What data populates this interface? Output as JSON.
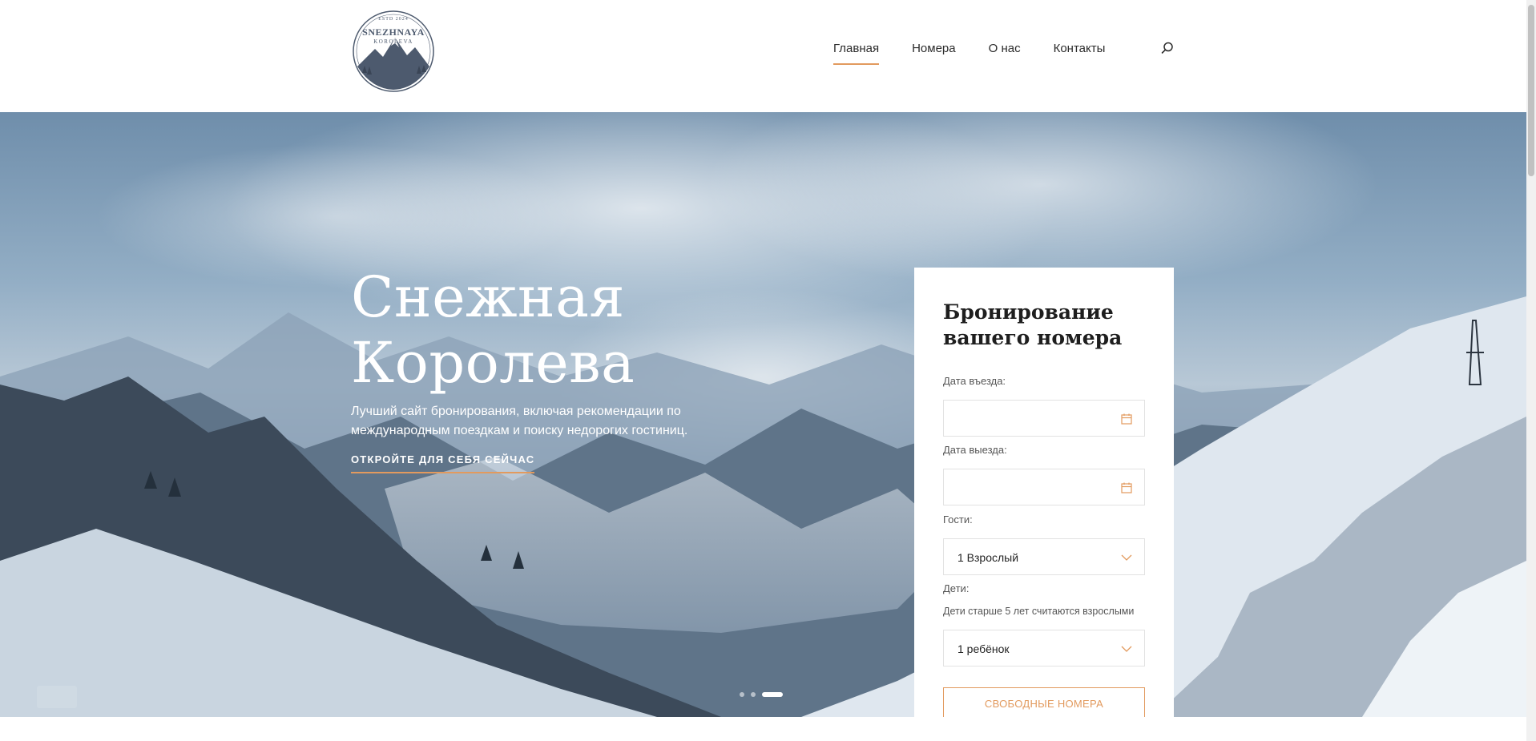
{
  "header": {
    "logo": {
      "line_top": "ESTD 2024",
      "line_main": "SNEZHNAYA",
      "line_sub": "KOROLEVA"
    },
    "nav": [
      {
        "label": "Главная",
        "active": true
      },
      {
        "label": "Номера",
        "active": false
      },
      {
        "label": "О нас",
        "active": false
      },
      {
        "label": "Контакты",
        "active": false
      }
    ],
    "search_icon": "search-icon"
  },
  "hero": {
    "title_line1": "Снежная",
    "title_line2": "Королева",
    "subtitle": "Лучший сайт бронирования, включая рекомендации по международным поездкам и поиску недорогих гостиниц.",
    "cta": "ОТКРОЙТЕ ДЛЯ СЕБЯ СЕЙЧАС",
    "slides": {
      "count": 3,
      "active_index": 2
    }
  },
  "booking": {
    "title": "Бронирование вашего номера",
    "checkin_label": "Дата въезда:",
    "checkin_value": "",
    "checkout_label": "Дата выезда:",
    "checkout_value": "",
    "guests_label": "Гости:",
    "guests_value": "1 Взрослый",
    "children_label": "Дети:",
    "children_note": "Дети старше 5 лет считаются взрослыми",
    "children_value": "1 ребёнок",
    "submit_label": "СВОБОДНЫЕ НОМЕРА"
  },
  "colors": {
    "accent": "#e29a5e",
    "text": "#222222",
    "logo": "#4d5a6e"
  }
}
